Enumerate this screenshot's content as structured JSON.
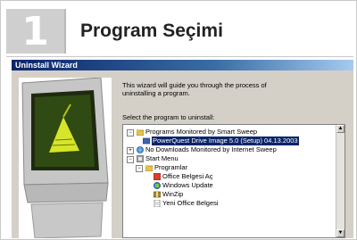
{
  "header": {
    "step_number": "1",
    "title": "Program Seçimi"
  },
  "wizard": {
    "window_title": "Uninstall Wizard",
    "intro_text": "This wizard will guide you through the process of uninstalling a program.",
    "select_label": "Select the program to uninstall:",
    "tree": [
      {
        "label": "Programs Monitored by Smart Sweep",
        "expander": "−"
      },
      {
        "label": "PowerQuest Drive Image 5.0 (Setup) 04.13.2003",
        "selected": true
      },
      {
        "label": "No Downloads Monitored by Internet Sweep",
        "expander": "+"
      },
      {
        "label": "Start Menu",
        "expander": "−"
      },
      {
        "label": "Programlar",
        "expander": "−"
      },
      {
        "label": "Office Belgesi Aç"
      },
      {
        "label": "Windows Update"
      },
      {
        "label": "WinZip"
      },
      {
        "label": "Yeni Office Belgesi"
      }
    ]
  },
  "colors": {
    "selection": "#0a246a",
    "titlebar": "#0a246a",
    "dialog_bg": "#d4d0c8"
  }
}
